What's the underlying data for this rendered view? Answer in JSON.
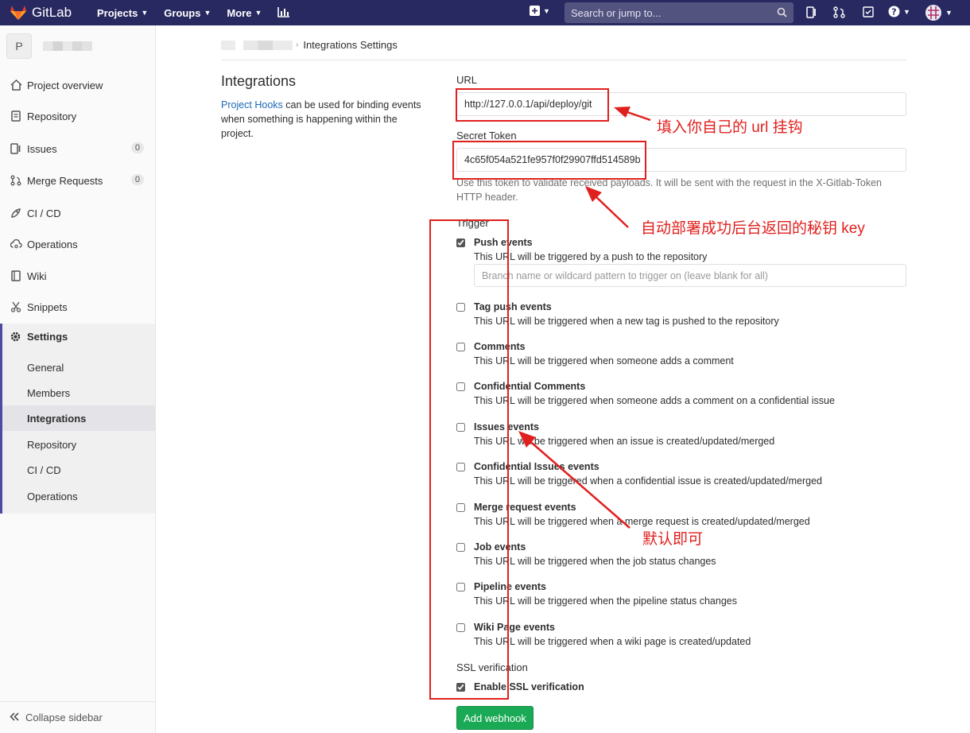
{
  "navbar": {
    "brand": "GitLab",
    "links": [
      "Projects",
      "Groups",
      "More"
    ],
    "search_placeholder": "Search or jump to..."
  },
  "sidebar": {
    "avatar_letter": "P",
    "items": [
      {
        "label": "Project overview",
        "icon": "home-icon"
      },
      {
        "label": "Repository",
        "icon": "doc-icon"
      },
      {
        "label": "Issues",
        "icon": "issues-icon",
        "count": "0"
      },
      {
        "label": "Merge Requests",
        "icon": "merge-icon",
        "count": "0"
      },
      {
        "label": "CI / CD",
        "icon": "rocket-icon"
      },
      {
        "label": "Operations",
        "icon": "cloud-gear-icon"
      },
      {
        "label": "Wiki",
        "icon": "book-icon"
      },
      {
        "label": "Snippets",
        "icon": "scissors-icon"
      }
    ],
    "settings": {
      "label": "Settings",
      "sub": [
        "General",
        "Members",
        "Integrations",
        "Repository",
        "CI / CD",
        "Operations"
      ]
    },
    "collapse": "Collapse sidebar"
  },
  "breadcrumb": {
    "current": "Integrations Settings"
  },
  "intro": {
    "title": "Integrations",
    "link": "Project Hooks",
    "desc": " can be used for binding events when something is happening within the project."
  },
  "form": {
    "url_label": "URL",
    "url_value": "http://127.0.0.1/api/deploy/git",
    "token_label": "Secret Token",
    "token_value": "4c65f054a521fe957f0f29907ffd514589b",
    "token_help": "Use this token to validate received payloads. It will be sent with the request in the X-Gitlab-Token HTTP header.",
    "trigger_label": "Trigger",
    "branch_placeholder": "Branch name or wildcard pattern to trigger on (leave blank for all)",
    "triggers": [
      {
        "name": "Push events",
        "desc": "This URL will be triggered by a push to the repository",
        "checked": true
      },
      {
        "name": "Tag push events",
        "desc": "This URL will be triggered when a new tag is pushed to the repository",
        "checked": false
      },
      {
        "name": "Comments",
        "desc": "This URL will be triggered when someone adds a comment",
        "checked": false
      },
      {
        "name": "Confidential Comments",
        "desc": "This URL will be triggered when someone adds a comment on a confidential issue",
        "checked": false
      },
      {
        "name": "Issues events",
        "desc": "This URL will be triggered when an issue is created/updated/merged",
        "checked": false
      },
      {
        "name": "Confidential Issues events",
        "desc": "This URL will be triggered when a confidential issue is created/updated/merged",
        "checked": false
      },
      {
        "name": "Merge request events",
        "desc": "This URL will be triggered when a merge request is created/updated/merged",
        "checked": false
      },
      {
        "name": "Job events",
        "desc": "This URL will be triggered when the job status changes",
        "checked": false
      },
      {
        "name": "Pipeline events",
        "desc": "This URL will be triggered when the pipeline status changes",
        "checked": false
      },
      {
        "name": "Wiki Page events",
        "desc": "This URL will be triggered when a wiki page is created/updated",
        "checked": false
      }
    ],
    "ssl_label": "SSL verification",
    "ssl_option": "Enable SSL verification",
    "ssl_checked": true,
    "submit": "Add webhook"
  },
  "annotations": {
    "url_note": "填入你自己的 url 挂钩",
    "token_note": "自动部署成功后台返回的秘钥 key",
    "default_note": "默认即可",
    "color": "#e0201e"
  }
}
